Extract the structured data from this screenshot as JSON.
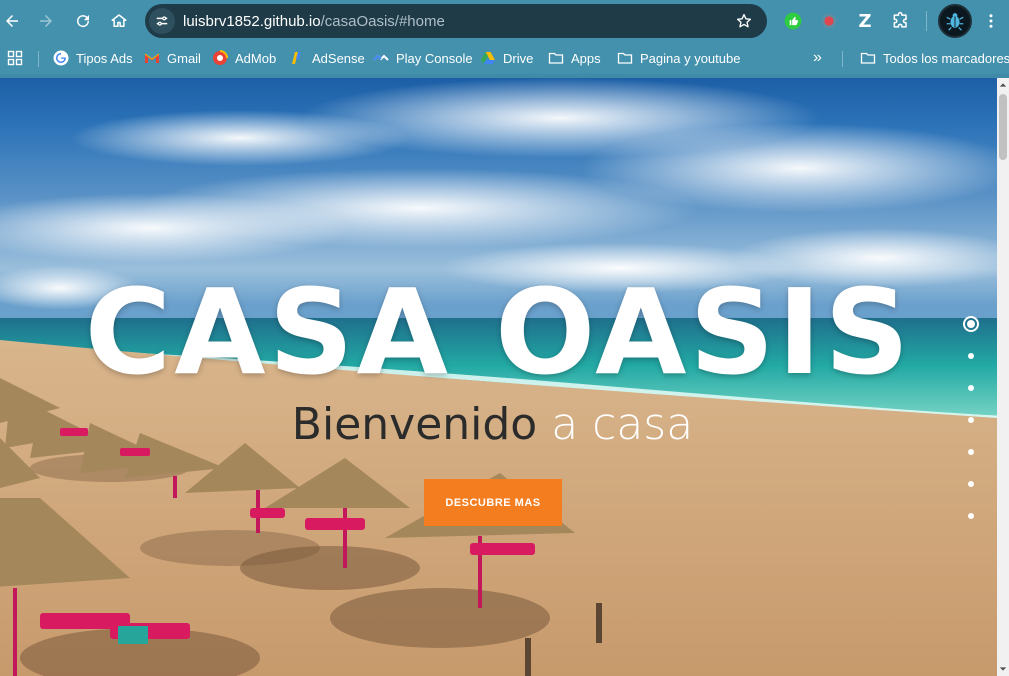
{
  "browser": {
    "url_host": "luisbrv1852.github.io",
    "url_path": "/casaOasis/#home",
    "nav_icons": [
      "back-arrow-icon",
      "forward-arrow-icon",
      "reload-icon",
      "home-icon"
    ],
    "extensions": [
      "thumbs-up-extension-icon",
      "record-extension-icon",
      "z-extension-icon",
      "puzzle-extensions-icon"
    ],
    "ext_z_label": "Z",
    "menu_icon": "kebab-menu-icon"
  },
  "bookmarks": {
    "items": [
      {
        "label": "Tipos Ads",
        "icon": "google-icon"
      },
      {
        "label": "Gmail",
        "icon": "gmail-icon"
      },
      {
        "label": "AdMob",
        "icon": "admob-icon"
      },
      {
        "label": "AdSense",
        "icon": "adsense-icon"
      },
      {
        "label": "Play Console",
        "icon": "play-console-icon"
      },
      {
        "label": "Drive",
        "icon": "drive-icon"
      },
      {
        "label": "Apps",
        "icon": "folder-icon"
      },
      {
        "label": "Pagina y youtube",
        "icon": "folder-icon"
      }
    ],
    "overflow": "»",
    "all_bookmarks": "Todos los marcadores"
  },
  "hero": {
    "title": "CASA OASIS",
    "subtitle_dark": "Bienvenido",
    "subtitle_light": " a casa",
    "cta_label": "DESCUBRE MAS"
  },
  "section_nav": {
    "count": 7,
    "active_index": 0
  },
  "colors": {
    "chrome": "#4391ad",
    "cta": "#f47d20",
    "omnibox": "#1f3b48"
  }
}
